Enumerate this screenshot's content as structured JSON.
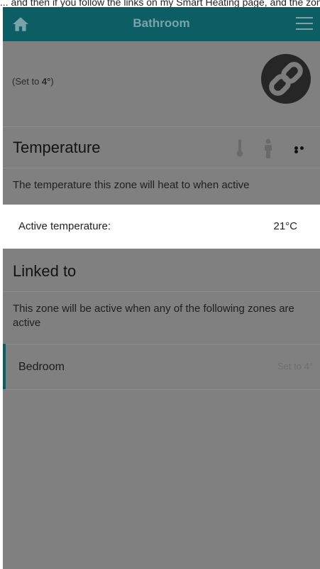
{
  "top_caption": "... and then if you follow the links on my Smart Heating page, and the zone...",
  "app_bar": {
    "title": "Bathroom",
    "home_icon": "home-icon",
    "menu_icon": "hamburger-menu-icon"
  },
  "status": {
    "prefix": "(Set to ",
    "value": "4°",
    "suffix": ")",
    "link_icon": "link-icon"
  },
  "temperature": {
    "heading": "Temperature",
    "description": "The temperature this zone will heat to when active",
    "active_label": "Active temperature:",
    "active_value": "21°C"
  },
  "linked": {
    "heading": "Linked to",
    "description": "This zone will be active when any of the following zones are active",
    "zones": [
      {
        "name": "Bedroom",
        "status": "Set to 4°"
      }
    ]
  },
  "colors": {
    "app_bar": "#0d5d65",
    "overlay": "#808080",
    "accent": "#0d5d65"
  }
}
